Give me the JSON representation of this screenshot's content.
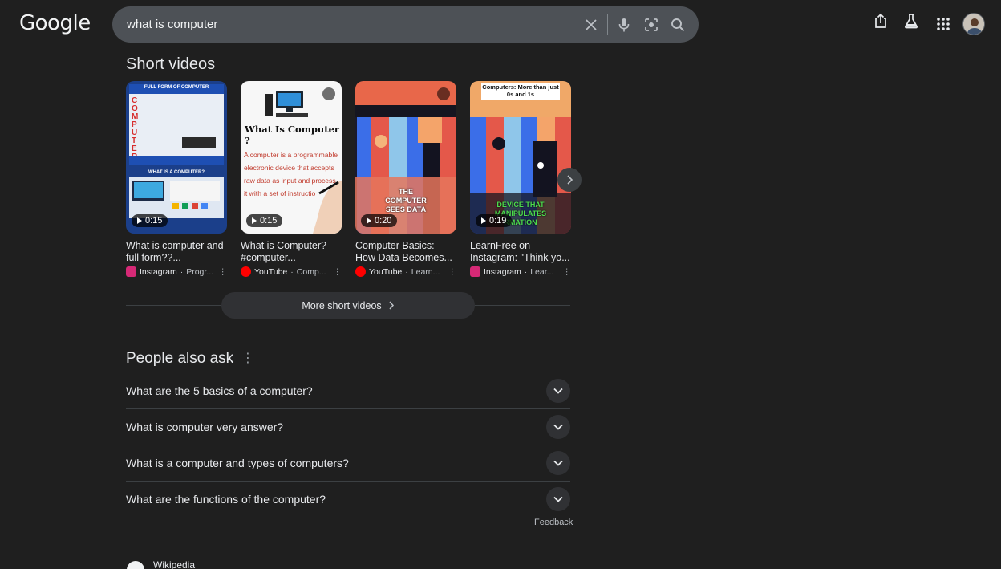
{
  "logo": "Google",
  "search": {
    "value": "what is computer"
  },
  "short_videos": {
    "title": "Short videos",
    "items": [
      {
        "title": "What is computer and full form??...",
        "duration": "0:15",
        "source": "Instagram",
        "meta": "Progr..."
      },
      {
        "title": "What is Computer? #computer...",
        "duration": "0:15",
        "source": "YouTube",
        "meta": "Comp..."
      },
      {
        "title": "Computer Basics: How Data Becomes...",
        "duration": "0:20",
        "source": "YouTube",
        "meta": "Learn..."
      },
      {
        "title": "LearnFree on Instagram: \"Think yo...",
        "duration": "0:19",
        "source": "Instagram",
        "meta": "Lear..."
      }
    ],
    "thumb_texts": {
      "t1_header": "FULL FORM OF COMPUTER",
      "t1_sub": "WHAT IS A COMPUTER?",
      "t2_heading": "What Is Computer ?",
      "t2_body": "A computer is a programmable electronic device that accepts raw data as input and process it with a set of instructio",
      "t3_caption": "THE COMPUTER SEES DATA",
      "t4_header": "Computers: More than just 0s and 1s",
      "t4_caption": "DEVICE THAT MANIPULATES RMATION"
    },
    "more_label": "More short videos"
  },
  "people_also_ask": {
    "title": "People also ask",
    "questions": [
      "What are the 5 basics of a computer?",
      "What is computer very answer?",
      "What is a computer and types of computers?",
      "What are the functions of the computer?"
    ],
    "feedback": "Feedback"
  },
  "next_result": {
    "source": "Wikipedia"
  },
  "colors": {
    "background": "#1f1f1f",
    "search_bg": "#4d5156",
    "youtube": "#ff0000",
    "instagram": "#d62976"
  }
}
